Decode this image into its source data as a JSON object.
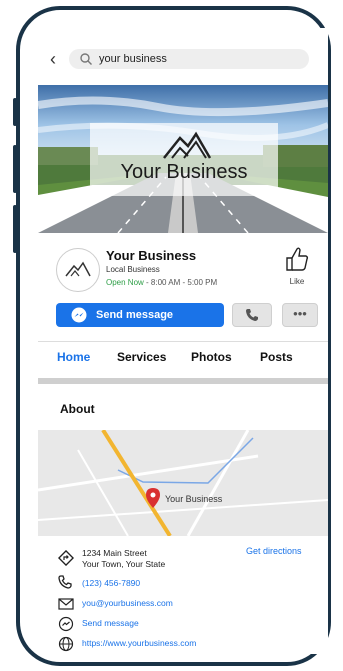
{
  "search": {
    "query": "your business",
    "back_icon": "back-arrow-icon",
    "search_icon": "search-icon"
  },
  "cover": {
    "title": "Your Business"
  },
  "profile": {
    "name": "Your Business",
    "category": "Local Business",
    "open_status": "Open Now",
    "hours": " - 8:00 AM - 5:00 PM",
    "like_label": "Like"
  },
  "actions": {
    "send_label": "Send message",
    "more_label": "•••"
  },
  "tabs": [
    {
      "label": "Home"
    },
    {
      "label": "Services"
    },
    {
      "label": "Photos"
    },
    {
      "label": "Posts"
    }
  ],
  "about": {
    "heading": "About",
    "map_label": "Your Business",
    "address_line1": "1234 Main Street",
    "address_line2": "Your Town, Your State",
    "directions": "Get directions",
    "phone": "(123) 456-7890",
    "email": "you@yourbusiness.com",
    "message": "Send message",
    "website": "https://www.yourbusiness.com"
  },
  "colors": {
    "accent": "#1a73e8",
    "open": "#2e9e47",
    "frame": "#1a3347"
  }
}
